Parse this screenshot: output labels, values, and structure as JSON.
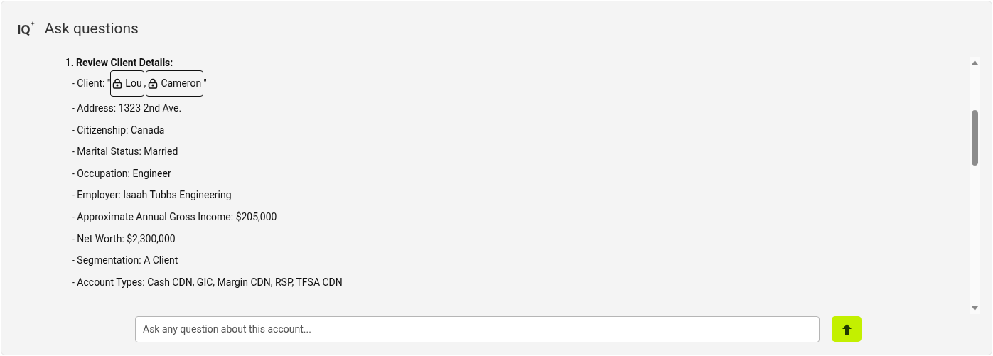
{
  "header": {
    "logo": "IQ",
    "title": "Ask questions"
  },
  "content": {
    "heading": "1. **Review Client Details:**",
    "client": {
      "prefix": "- Client: \"",
      "chips": [
        {
          "label": "Lou",
          "locked": true
        },
        {
          "label": "Cameron",
          "locked": true
        }
      ],
      "separator": ",",
      "suffix": "\""
    },
    "lines": [
      "- Address: 1323 2nd Ave.",
      "- Citizenship: Canada",
      "- Marital Status: Married",
      "- Occupation: Engineer",
      "- Employer: Isaah Tubbs Engineering",
      "- Approximate Annual Gross Income: $205,000",
      "- Net Worth: $2,300,000",
      "- Segmentation: A Client",
      "- Account Types: Cash CDN, GIC, Margin CDN, RSP, TFSA CDN"
    ]
  },
  "question_field": {
    "placeholder": "Ask any question about this account..."
  }
}
